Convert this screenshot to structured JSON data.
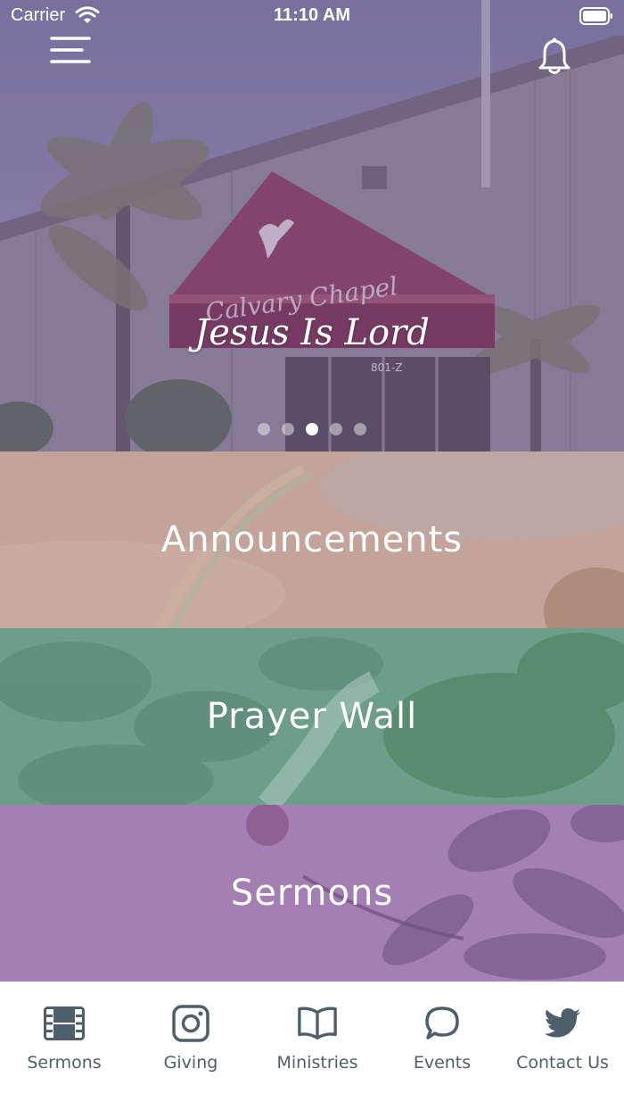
{
  "status_bar": {
    "carrier": "Carrier",
    "time": "11:10 AM"
  },
  "hero": {
    "caption": "Jesus Is Lord",
    "sign_text": "Calvary Chapel",
    "address_text": "801-Z",
    "carousel": {
      "count": 5,
      "active_index": 2
    }
  },
  "tiles": [
    {
      "label": "Announcements",
      "color": "#c4a49a"
    },
    {
      "label": "Prayer Wall",
      "color": "#6d9e8a"
    },
    {
      "label": "Sermons",
      "color": "#a47fb4"
    }
  ],
  "tab_bar": {
    "items": [
      {
        "label": "Sermons",
        "icon": "film-icon"
      },
      {
        "label": "Giving",
        "icon": "instagram-icon"
      },
      {
        "label": "Ministries",
        "icon": "book-icon"
      },
      {
        "label": "Events",
        "icon": "chat-bubble-icon"
      },
      {
        "label": "Contact Us",
        "icon": "twitter-icon"
      }
    ],
    "icon_color": "#4d5f6b"
  }
}
